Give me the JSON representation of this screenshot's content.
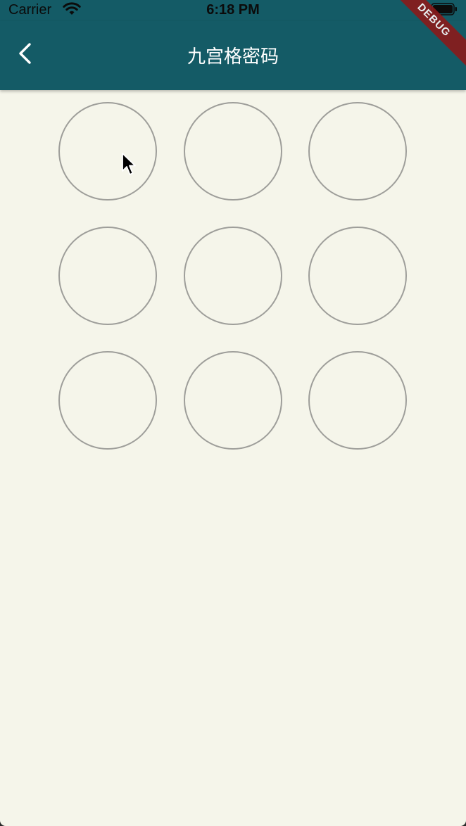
{
  "status_bar": {
    "carrier": "Carrier",
    "time": "6:18 PM"
  },
  "app_bar": {
    "title": "九宫格密码",
    "back_icon": "chevron-left-icon"
  },
  "debug_banner": {
    "label": "DEBUG"
  },
  "pattern_lock": {
    "rows": 3,
    "columns": 3,
    "nodes": [
      1,
      2,
      3,
      4,
      5,
      6,
      7,
      8,
      9
    ],
    "selected": []
  },
  "colors": {
    "app_bar": "#145B66",
    "background": "#F5F5EA",
    "circle_stroke": "#9E9E9A",
    "debug_banner": "#8B1A1A"
  }
}
